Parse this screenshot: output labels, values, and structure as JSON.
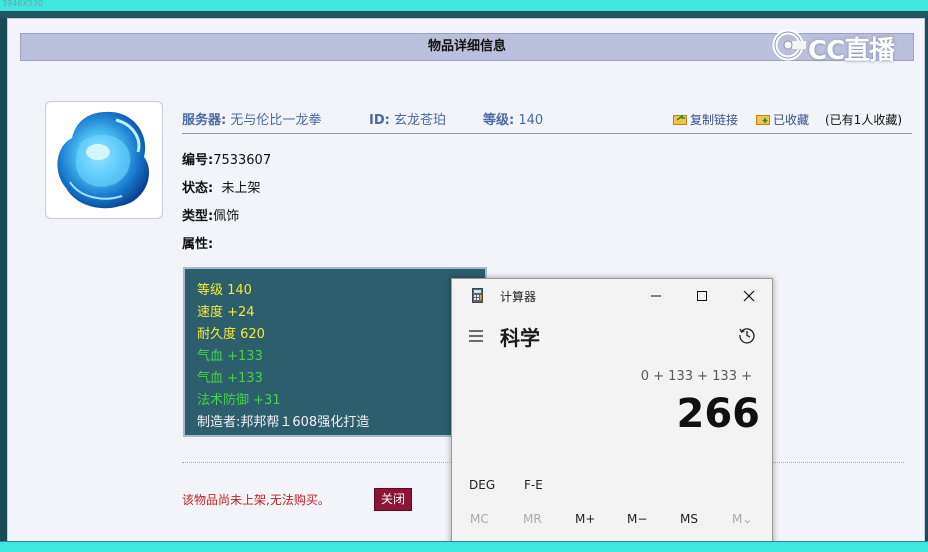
{
  "top_bar_label": "3946X530",
  "panel": {
    "title": "物品详细信息"
  },
  "watermark": {
    "text": "CC直播"
  },
  "item": {
    "server_label": "服务器:",
    "server_value": "无与伦比一龙拳",
    "id_label": "ID:",
    "id_value": "玄龙苍珀",
    "level_label": "等级:",
    "level_value": "140",
    "copy_link_label": "复制链接",
    "favorited_label": "已收藏",
    "fav_count_text": "(已有1人收藏)",
    "number_label": "编号:",
    "number_value": "7533607",
    "status_label": "状态:",
    "status_value": "未上架",
    "type_label": "类型:",
    "type_value": "佩饰",
    "attr_label": "属性:"
  },
  "attributes": [
    {
      "text": "等级 140",
      "color": "#f1ec3a"
    },
    {
      "text": "速度 +24",
      "color": "#f1ec3a"
    },
    {
      "text": "耐久度 620",
      "color": "#f1ec3a"
    },
    {
      "text": "气血 +133",
      "color": "#46d24a"
    },
    {
      "text": "气血 +133",
      "color": "#46d24a"
    },
    {
      "text": "法术防御 +31",
      "color": "#46d24a"
    },
    {
      "text": "制造者:邦邦帮１608强化打造",
      "color": "#f2f2f2"
    }
  ],
  "footer": {
    "notice": "该物品尚未上架,无法购买。",
    "close_label": "关闭"
  },
  "calculator": {
    "window_title": "计算器",
    "mode": "科学",
    "expression": "0 + 133 + 133 +",
    "result": "266",
    "row1": [
      "DEG",
      "F-E"
    ],
    "row2": [
      "MC",
      "MR",
      "M+",
      "M−",
      "MS",
      "M⌄"
    ]
  },
  "colors": {
    "header_bg": "#b9bfdc",
    "attr_box_bg": "#2d5e6c",
    "close_button_bg": "#8b1437",
    "notice_red": "#c02020",
    "label_blue": "#4a6aa5"
  }
}
